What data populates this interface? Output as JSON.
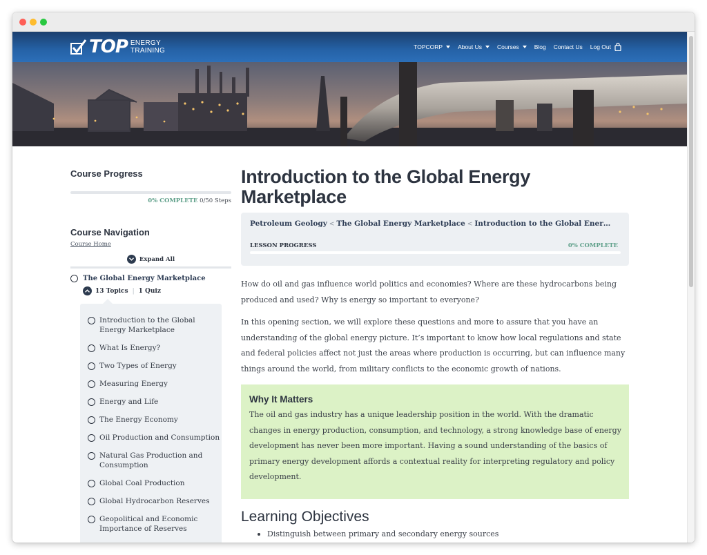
{
  "brand": {
    "logo_top": "TOP",
    "logo_line1": "ENERGY",
    "logo_line2": "TRAINING"
  },
  "nav": {
    "items": [
      {
        "label": "TOPCORP",
        "dropdown": true
      },
      {
        "label": "About Us",
        "dropdown": true
      },
      {
        "label": "Courses",
        "dropdown": true
      },
      {
        "label": "Blog",
        "dropdown": false
      },
      {
        "label": "Contact Us",
        "dropdown": false
      },
      {
        "label": "Log Out",
        "dropdown": false
      }
    ],
    "cart_icon": "shopping-bag-icon"
  },
  "sidebar": {
    "progress_heading": "Course Progress",
    "progress_fraction": 0,
    "progress_pct": "0% COMPLETE",
    "progress_steps": "0/50 Steps",
    "nav_heading": "Course Navigation",
    "course_home": "Course Home",
    "expand_all": "Expand All",
    "lesson_title": "The Global Energy Marketplace",
    "topics_count": "13 Topics",
    "quiz_count": "1 Quiz",
    "topics": [
      "Introduction to the Global Energy Marketplace",
      "What Is Energy?",
      "Two Types of Energy",
      "Measuring Energy",
      "Energy and Life",
      "The Energy Economy",
      "Oil Production and Consumption",
      "Natural Gas Production and Consumption",
      "Global Coal Production",
      "Global Hydrocarbon Reserves",
      "Geopolitical and Economic Importance of Reserves"
    ]
  },
  "main": {
    "title": "Introduction to the Global Energy Marketplace",
    "breadcrumb": [
      "Petroleum Geology",
      "The Global Energy Marketplace",
      "Introduction to the Global Energy Marketplace"
    ],
    "breadcrumb_sep": "<",
    "lesson_progress_label": "LESSON PROGRESS",
    "lesson_progress_pct": "0% COMPLETE",
    "lesson_progress_fraction": 0,
    "para1": "How do oil and gas influence world politics and economies? Where are these hydrocarbons being produced and used? Why is energy so important to everyone?",
    "para2": "In this opening section, we will explore these questions and more to assure that you have an understanding of the global energy picture. It’s important to know how local regulations and state and federal policies affect not just the areas where production is occurring, but can influence many things around the world, from military conflicts to the economic growth of nations.",
    "matters_heading": "Why It Matters",
    "matters_text": "The oil and gas industry has a unique leadership position in the world. With the dramatic changes in energy production, consumption, and technology, a strong knowledge base of energy development has never been more important. Having a sound understanding of the basics of primary energy development affords a contextual reality for interpreting regulatory and policy development.",
    "objectives_heading": "Learning Objectives",
    "objectives": [
      "Distinguish between primary and secondary energy sources"
    ]
  },
  "colors": {
    "header_dark": "#1b3f6e",
    "header_light": "#2c6fb8",
    "accent_green": "#5fa08a",
    "callout_bg": "#dcf2c6",
    "panel_bg": "#eef1f4"
  }
}
